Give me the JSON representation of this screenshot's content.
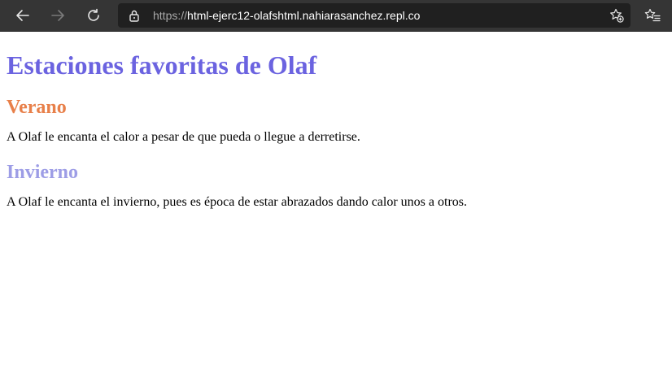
{
  "browser": {
    "url_scheme": "https://",
    "url_host": "html-ejerc12-olafshtml.nahiarasanchez.repl.co",
    "icons": {
      "back": "back-arrow-icon",
      "forward": "forward-arrow-icon",
      "reload": "reload-icon",
      "lock": "lock-icon",
      "add_favorite": "add-favorite-icon",
      "favorites": "favorites-icon"
    },
    "colors": {
      "toolbar": "#353535",
      "address_bar": "#202020",
      "url_text": "#ffffff",
      "url_scheme": "#a8a8a8"
    }
  },
  "page": {
    "title": "Estaciones favoritas de Olaf",
    "title_color": "#6b63e0",
    "sections": [
      {
        "heading": "Verano",
        "heading_color": "#e8804a",
        "text": "A Olaf le encanta el calor a pesar de que pueda o llegue a derretirse."
      },
      {
        "heading": "Invierno",
        "heading_color": "#9d9de6",
        "text": "A Olaf le encanta el invierno, pues es época de estar abrazados dando calor unos a otros."
      }
    ]
  }
}
